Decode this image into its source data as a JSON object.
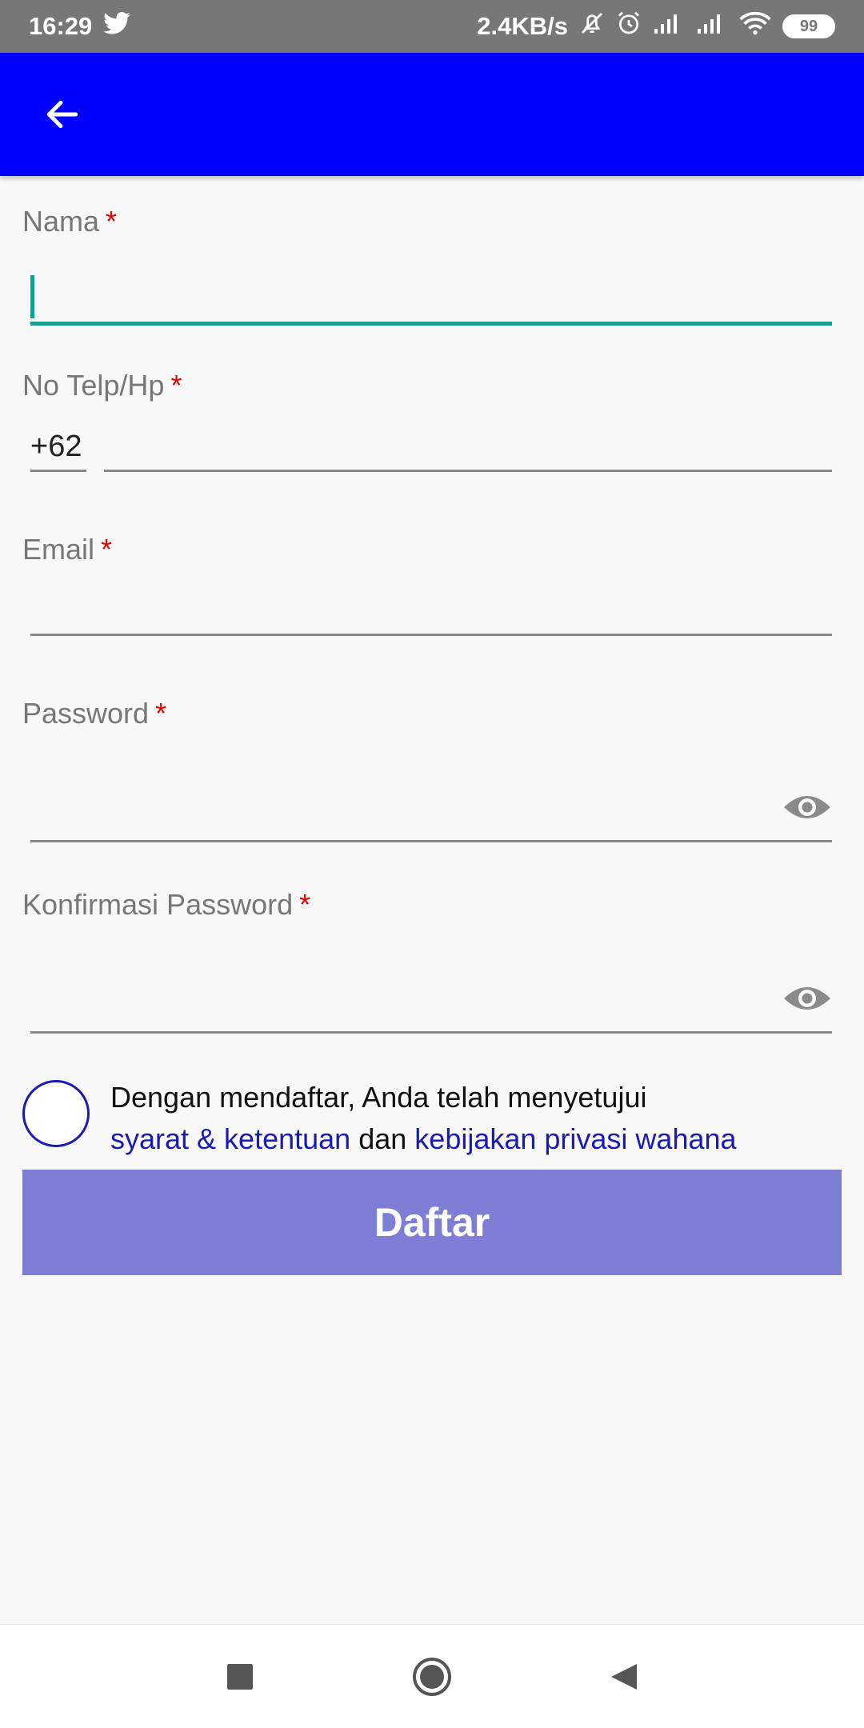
{
  "status_bar": {
    "time": "16:29",
    "network_speed": "2.4KB/s",
    "battery": "99",
    "icons": [
      "twitter-icon",
      "mute-bell-icon",
      "alarm-icon",
      "signal-icon",
      "signal-icon",
      "wifi-icon",
      "battery-icon"
    ]
  },
  "app_bar": {
    "color": "#0000ff",
    "back_icon": "arrow-left-icon"
  },
  "form": {
    "nama": {
      "label": "Nama",
      "required": "*",
      "value": ""
    },
    "phone": {
      "label": "No Telp/Hp",
      "required": "*",
      "prefix": "+62",
      "value": ""
    },
    "email": {
      "label": "Email",
      "required": "*",
      "value": ""
    },
    "password": {
      "label": "Password",
      "required": "*",
      "value": "",
      "toggle_icon": "eye-icon"
    },
    "confirm_password": {
      "label": "Konfirmasi Password",
      "required": "*",
      "value": "",
      "toggle_icon": "eye-icon"
    }
  },
  "agreement": {
    "text": "Dengan mendaftar, Anda telah menyetujui",
    "terms_link": "syarat & ketentuan",
    "connector": "dan",
    "privacy_link": "kebijakan privasi wahana",
    "checked": false
  },
  "submit": {
    "label": "Daftar",
    "color": "#7e7ed6"
  },
  "colors": {
    "accent": "#179e8f",
    "link": "#1a1ab5",
    "required": "#e00000"
  },
  "nav_bar": {
    "icons": [
      "square-icon",
      "circle-icon",
      "triangle-back-icon"
    ]
  }
}
